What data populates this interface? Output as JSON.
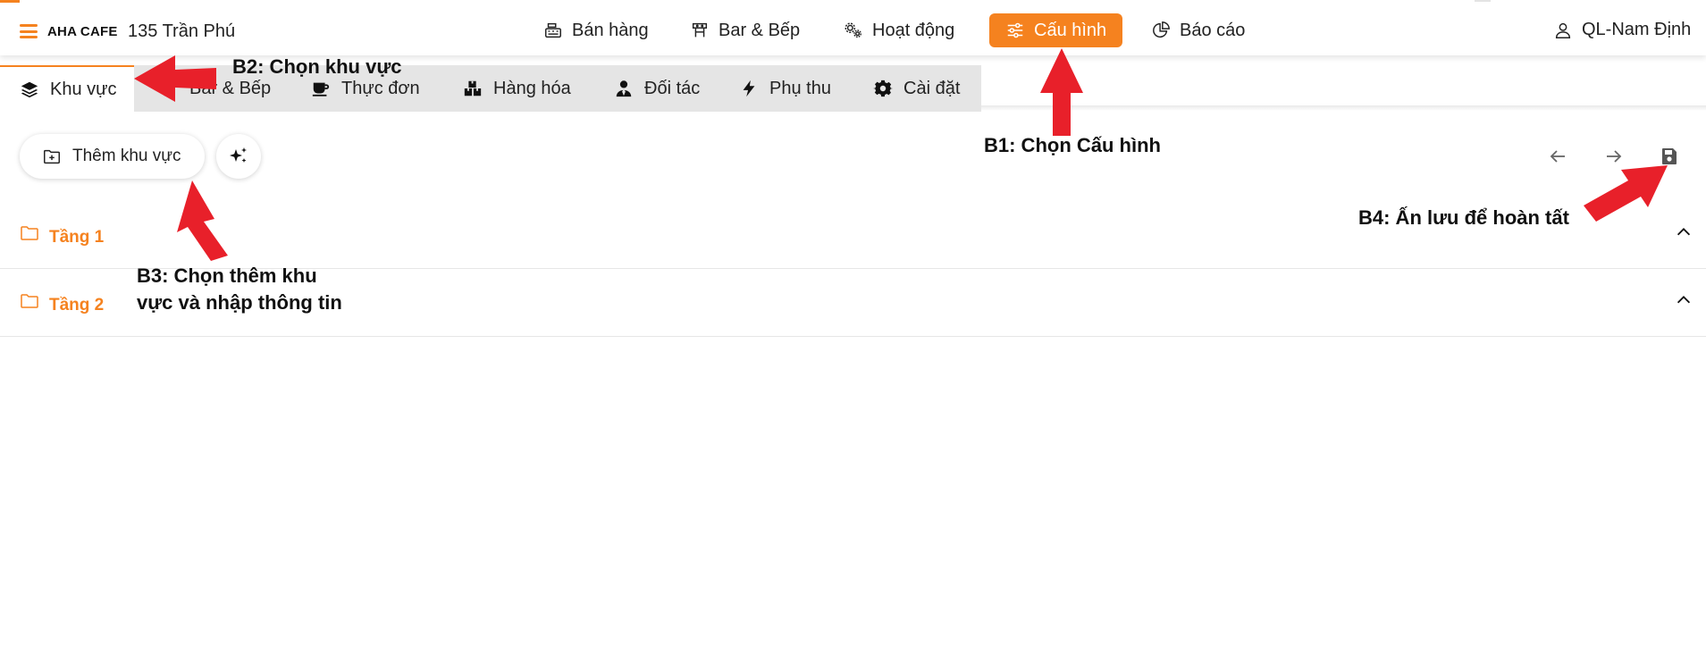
{
  "topbar": {
    "brand": "AHA CAFE",
    "branch": "135 Trần Phú",
    "nav": [
      {
        "label": "Bán hàng",
        "icon": "cash-register-icon"
      },
      {
        "label": "Bar & Bếp",
        "icon": "kitchen-icon"
      },
      {
        "label": "Hoạt động",
        "icon": "gears-icon"
      },
      {
        "label": "Cấu hình",
        "icon": "sliders-icon",
        "active": true
      },
      {
        "label": "Báo cáo",
        "icon": "pie-chart-icon"
      }
    ],
    "user": "QL-Nam Định"
  },
  "subtabs": [
    {
      "label": "Khu vực",
      "icon": "layers-icon",
      "active": true
    },
    {
      "label": "Bar & Bếp",
      "icon": "chef-icon"
    },
    {
      "label": "Thực đơn",
      "icon": "coffee-cup-icon"
    },
    {
      "label": "Hàng hóa",
      "icon": "boxes-icon"
    },
    {
      "label": "Đối tác",
      "icon": "user-tie-icon"
    },
    {
      "label": "Phụ thu",
      "icon": "bolt-icon"
    },
    {
      "label": "Cài đặt",
      "icon": "gear-icon"
    }
  ],
  "toolbar": {
    "add_area": "Thêm khu vực",
    "ai_icon": "sparkles-icon",
    "undo_icon": "arrow-left-icon",
    "redo_icon": "arrow-right-icon",
    "save_icon": "save-icon"
  },
  "areas": [
    {
      "name": "Tầng 1",
      "icon": "folder-icon",
      "state_icon": "chevron-up-icon"
    },
    {
      "name": "Tầng 2",
      "icon": "folder-icon",
      "state_icon": "chevron-up-icon"
    }
  ],
  "annotations": {
    "b1": "B1: Chọn Cấu hình",
    "b2": "B2: Chọn khu vực",
    "b3_line1": "B3: Chọn thêm khu",
    "b3_line2": "vực và nhập thông tin",
    "b4": "B4: Ấn lưu để hoàn tất",
    "arrow_color": "#e8202a"
  },
  "colors": {
    "accent": "#f5821f",
    "tab_strip": "#e5e5e5",
    "text": "#1f1f1f"
  }
}
